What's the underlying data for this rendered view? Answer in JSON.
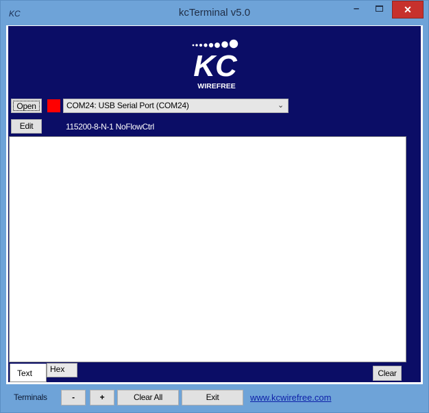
{
  "window": {
    "app_icon_text": "KC",
    "title": "kcTerminal v5.0",
    "minimize_icon": "minimize-icon",
    "maximize_icon": "maximize-icon",
    "close_glyph": "✕"
  },
  "logo": {
    "text": "KC",
    "subtitle": "WIREFREE"
  },
  "connection": {
    "open_label": "Open",
    "edit_label": "Edit",
    "status_color": "#ff0000",
    "port_selected": "COM24:  USB Serial Port (COM24)",
    "port_settings": "115200-8-N-1 NoFlowCtrl"
  },
  "terminal": {
    "content": "",
    "tabs": [
      {
        "label": "Text",
        "active": true
      },
      {
        "label": "Hex",
        "active": false
      }
    ],
    "clear_label": "Clear"
  },
  "bottom": {
    "terminals_label": "Terminals",
    "minus_label": "-",
    "plus_label": "+",
    "clear_all_label": "Clear All",
    "exit_label": "Exit",
    "website": "www.kcwirefree.com"
  },
  "colors": {
    "frame": "#6ea3d8",
    "panel": "#0b0d66",
    "close": "#c7312d",
    "link": "#0c1fa8"
  }
}
